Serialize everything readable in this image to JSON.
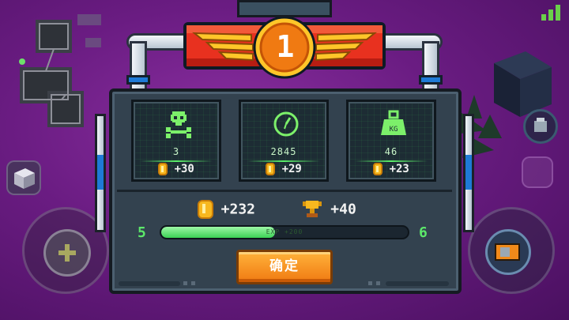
{
  "rank": {
    "number": "1"
  },
  "stats": [
    {
      "name": "kills",
      "icon": "skull-icon",
      "value": "3",
      "coins": "+30"
    },
    {
      "name": "time",
      "icon": "clock-icon",
      "value": "2845",
      "coins": "+29"
    },
    {
      "name": "weight",
      "icon": "weight-icon",
      "value": "46",
      "coins": "+23",
      "icon_label": "KG"
    }
  ],
  "totals": {
    "coins": "+232",
    "trophies": "+40"
  },
  "experience": {
    "current_level": "5",
    "next_level": "6",
    "label": "EXP +200",
    "progress": 0.46
  },
  "confirm_button": {
    "label": "确定"
  },
  "colors": {
    "accent_green": "#5ce86a",
    "coin": "#f7b81f",
    "button_orange": "#f07a12",
    "banner_red": "#e8311f"
  }
}
